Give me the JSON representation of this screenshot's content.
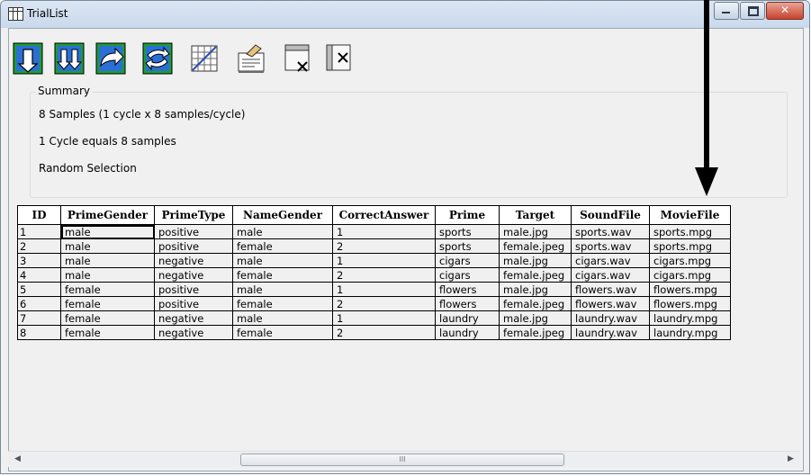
{
  "window": {
    "title": "TrialList"
  },
  "toolbar": {
    "buttons": [
      {
        "icon": "arrange-down-icon"
      },
      {
        "icon": "arrange-random-icon"
      },
      {
        "icon": "arrange-cycle-icon"
      },
      {
        "icon": "arrange-shuffle-icon"
      },
      {
        "icon": "grid-icon"
      },
      {
        "icon": "properties-icon"
      },
      {
        "icon": "delete-row-icon"
      },
      {
        "icon": "delete-column-icon"
      }
    ]
  },
  "summary": {
    "legend": "Summary",
    "line1": "8 Samples (1 cycle x 8 samples/cycle)",
    "line2": "1 Cycle equals 8 samples",
    "line3": "Random Selection"
  },
  "table": {
    "columns": [
      "ID",
      "PrimeGender",
      "PrimeType",
      "NameGender",
      "CorrectAnswer",
      "Prime",
      "Target",
      "SoundFile",
      "MovieFile"
    ],
    "rows": [
      [
        "1",
        "male",
        "positive",
        "male",
        "1",
        "sports",
        "male.jpg",
        "sports.wav",
        "sports.mpg"
      ],
      [
        "2",
        "male",
        "positive",
        "female",
        "2",
        "sports",
        "female.jpeg",
        "sports.wav",
        "sports.mpg"
      ],
      [
        "3",
        "male",
        "negative",
        "male",
        "1",
        "cigars",
        "male.jpg",
        "cigars.wav",
        "cigars.mpg"
      ],
      [
        "4",
        "male",
        "negative",
        "female",
        "2",
        "cigars",
        "female.jpeg",
        "cigars.wav",
        "cigars.mpg"
      ],
      [
        "5",
        "female",
        "positive",
        "male",
        "1",
        "flowers",
        "male.jpg",
        "flowers.wav",
        "flowers.mpg"
      ],
      [
        "6",
        "female",
        "positive",
        "female",
        "2",
        "flowers",
        "female.jpeg",
        "flowers.wav",
        "flowers.mpg"
      ],
      [
        "7",
        "female",
        "negative",
        "male",
        "1",
        "laundry",
        "male.jpg",
        "laundry.wav",
        "laundry.mpg"
      ],
      [
        "8",
        "female",
        "negative",
        "female",
        "2",
        "laundry",
        "female.jpeg",
        "laundry.wav",
        "laundry.mpg"
      ]
    ]
  },
  "scrollbar": {
    "thumb_grip": "III"
  },
  "colors": {
    "titlebar": "#dbe6f3",
    "close_button": "#c7432c",
    "annotation_arrow": "#000000"
  }
}
